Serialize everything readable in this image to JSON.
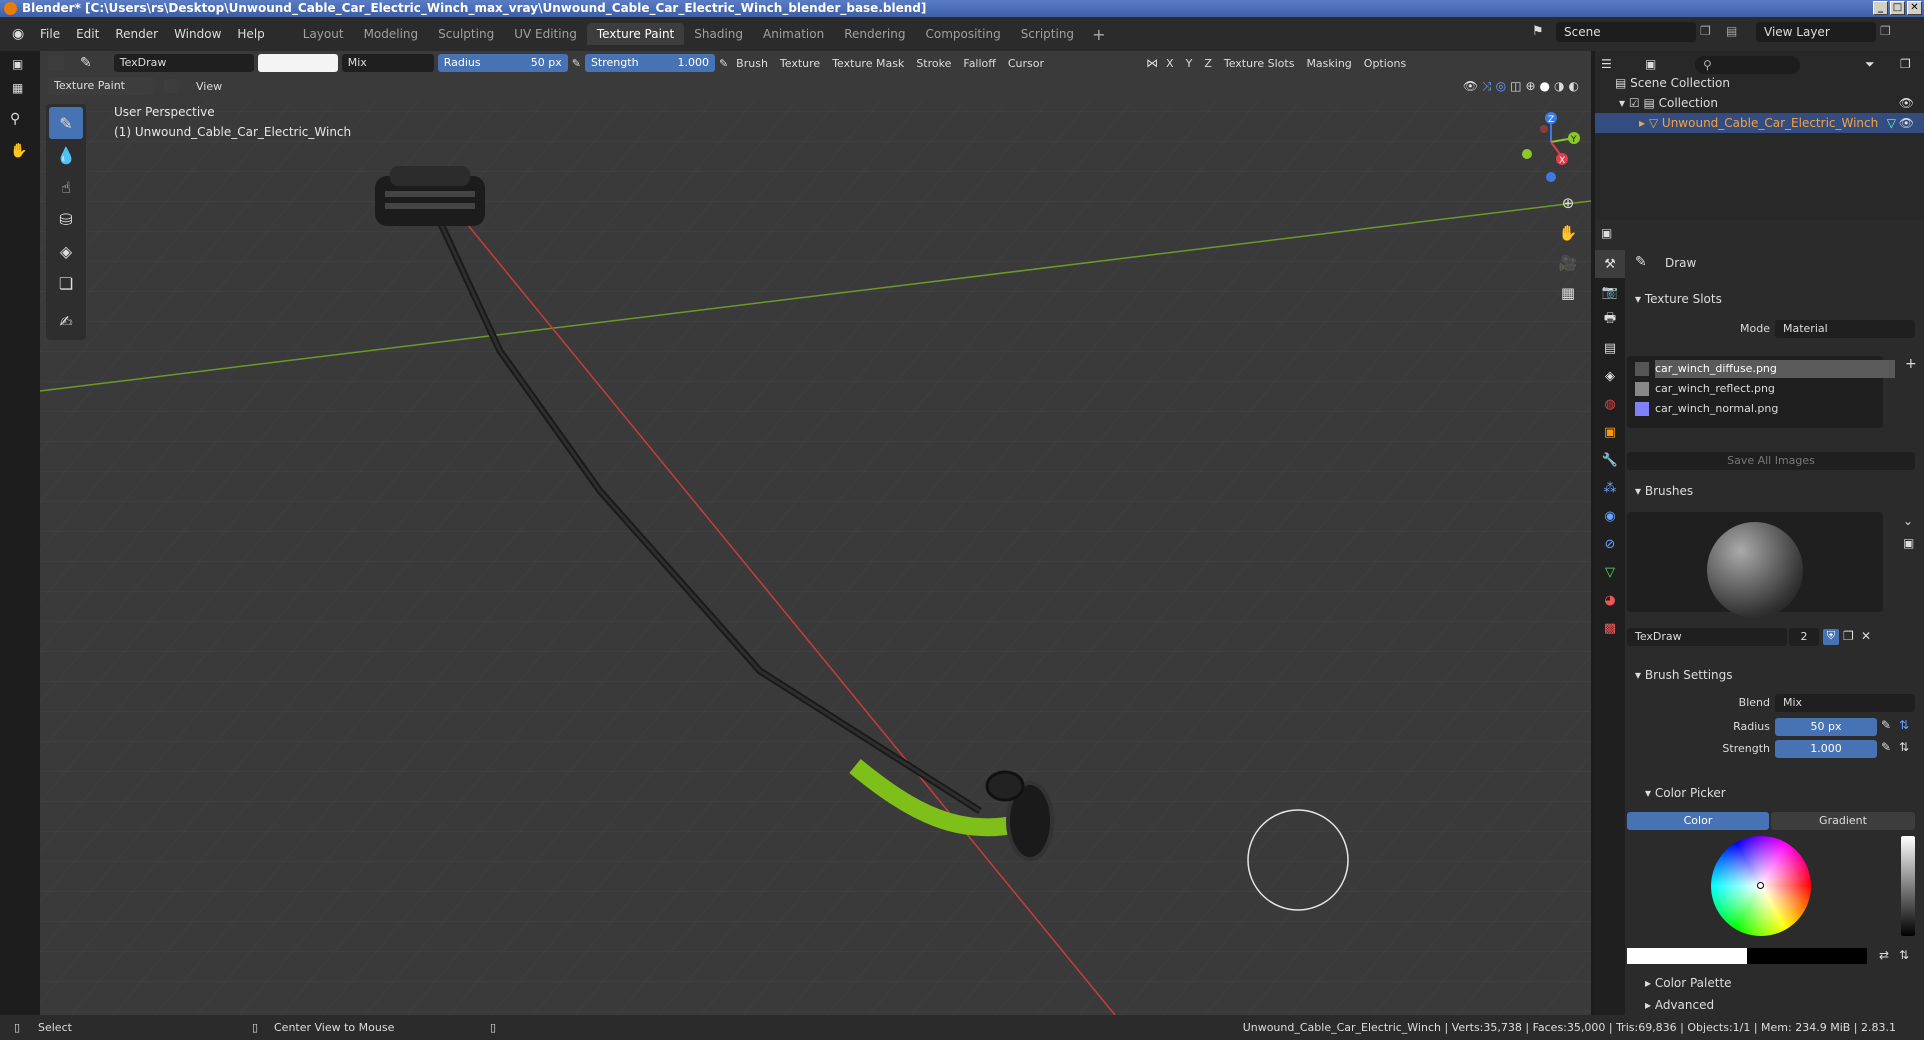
{
  "window": {
    "title": "Blender* [C:\\Users\\rs\\Desktop\\Unwound_Cable_Car_Electric_Winch_max_vray\\Unwound_Cable_Car_Electric_Winch_blender_base.blend]"
  },
  "menu": {
    "items": [
      "File",
      "Edit",
      "Render",
      "Window",
      "Help"
    ]
  },
  "workspaces": {
    "tabs": [
      "Layout",
      "Modeling",
      "Sculpting",
      "UV Editing",
      "Texture Paint",
      "Shading",
      "Animation",
      "Rendering",
      "Compositing",
      "Scripting"
    ],
    "add": "+"
  },
  "scene": {
    "name": "Scene",
    "view_layer": "View Layer"
  },
  "tool_header": {
    "brush_name": "TexDraw",
    "blend": "Mix",
    "radius_label": "Radius",
    "radius_value": "50 px",
    "strength_label": "Strength",
    "strength_value": "1.000",
    "menus": [
      "Brush",
      "Texture",
      "Texture Mask",
      "Stroke",
      "Falloff",
      "Cursor"
    ],
    "axes": [
      "X",
      "Y",
      "Z"
    ],
    "right_menus": [
      "Texture Slots",
      "Masking",
      "Options"
    ]
  },
  "vp_header": {
    "mode": "Texture Paint",
    "view": "View"
  },
  "viewport": {
    "perspective": "User Perspective",
    "object": "(1) Unwound_Cable_Car_Electric_Winch",
    "gizmo": [
      "Z",
      "Y",
      "X"
    ]
  },
  "outliner": {
    "root": "Scene Collection",
    "collection": "Collection",
    "object": "Unwound_Cable_Car_Electric_Winch"
  },
  "properties": {
    "tool_name": "Draw",
    "texture_slots": {
      "header": "Texture Slots",
      "mode_label": "Mode",
      "mode_value": "Material",
      "slots": [
        "car_winch_diffuse.png",
        "car_winch_reflect.png",
        "car_winch_normal.png"
      ],
      "save_all": "Save All Images"
    },
    "brushes": {
      "header": "Brushes",
      "name": "TexDraw",
      "users": "2"
    },
    "brush_settings": {
      "header": "Brush Settings",
      "blend_label": "Blend",
      "blend_value": "Mix",
      "radius_label": "Radius",
      "radius_value": "50 px",
      "strength_label": "Strength",
      "strength_value": "1.000"
    },
    "color_picker": {
      "header": "Color Picker",
      "tab_color": "Color",
      "tab_gradient": "Gradient"
    },
    "color_palette": "Color Palette",
    "advanced": "Advanced"
  },
  "statusbar": {
    "left_action": "Select",
    "mid_action": "Center View to Mouse",
    "stats": "Unwound_Cable_Car_Electric_Winch | Verts:35,738 | Faces:35,000 | Tris:69,836 | Objects:1/1 | Mem: 234.9 MiB | 2.83.1"
  },
  "colors": {
    "accent": "#4772b3",
    "viewport_bg": "#3a3a3a",
    "grid": "#444444",
    "x_axis": "#c83c3c",
    "y_axis": "#6c9a26",
    "selected_object": "#f5a142",
    "winch_hook": "#7fbf1a",
    "swatch_normal": "#8080ff"
  }
}
